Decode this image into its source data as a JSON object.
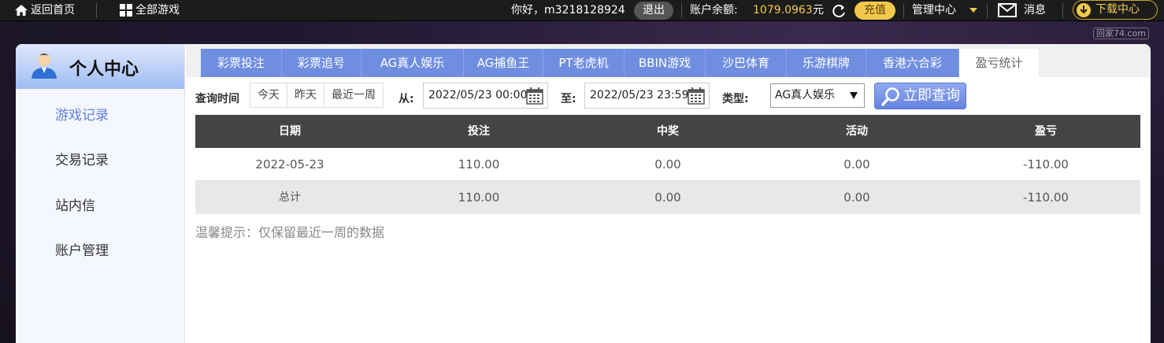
{
  "topbar": {
    "home": "返回首页",
    "all_games": "全部游戏",
    "greeting": "你好，m3218128924",
    "logout": "退出",
    "balance_label": "账户余额:",
    "balance_value": "1079.0963",
    "balance_unit": "元",
    "recharge": "充值",
    "admin": "管理中心",
    "messages": "消息",
    "download": "下载中心",
    "watermark": "回家74.com"
  },
  "sidebar": {
    "title": "个人中心",
    "items": [
      {
        "label": "游戏记录",
        "active": true
      },
      {
        "label": "交易记录",
        "active": false
      },
      {
        "label": "站内信",
        "active": false
      },
      {
        "label": "账户管理",
        "active": false
      }
    ]
  },
  "tabs": [
    {
      "label": "彩票投注",
      "active": false
    },
    {
      "label": "彩票追号",
      "active": false
    },
    {
      "label": "AG真人娱乐",
      "active": false
    },
    {
      "label": "AG捕鱼王",
      "active": false
    },
    {
      "label": "PT老虎机",
      "active": false
    },
    {
      "label": "BBIN游戏",
      "active": false
    },
    {
      "label": "沙巴体育",
      "active": false
    },
    {
      "label": "乐游棋牌",
      "active": false
    },
    {
      "label": "香港六合彩",
      "active": false
    },
    {
      "label": "盈亏统计",
      "active": true
    }
  ],
  "filter": {
    "query_time_label": "查询时间",
    "quick": [
      "今天",
      "昨天",
      "最近一周"
    ],
    "from_label": "从:",
    "from_value": "2022/05/23 00:00",
    "to_label": "至:",
    "to_value": "2022/05/23 23:59",
    "type_label": "类型:",
    "type_value": "AG真人娱乐",
    "search_button": "立即查询"
  },
  "table": {
    "headers": [
      "日期",
      "投注",
      "中奖",
      "活动",
      "盈亏"
    ],
    "rows": [
      [
        "2022-05-23",
        "110.00",
        "0.00",
        "0.00",
        "-110.00"
      ]
    ],
    "total": [
      "总计",
      "110.00",
      "0.00",
      "0.00",
      "-110.00"
    ]
  },
  "tip": "温馨提示：仅保留最近一周的数据",
  "colors": {
    "accent_blue": "#6f8ee0",
    "gold": "#f2c94c",
    "header_dark": "#444444"
  }
}
